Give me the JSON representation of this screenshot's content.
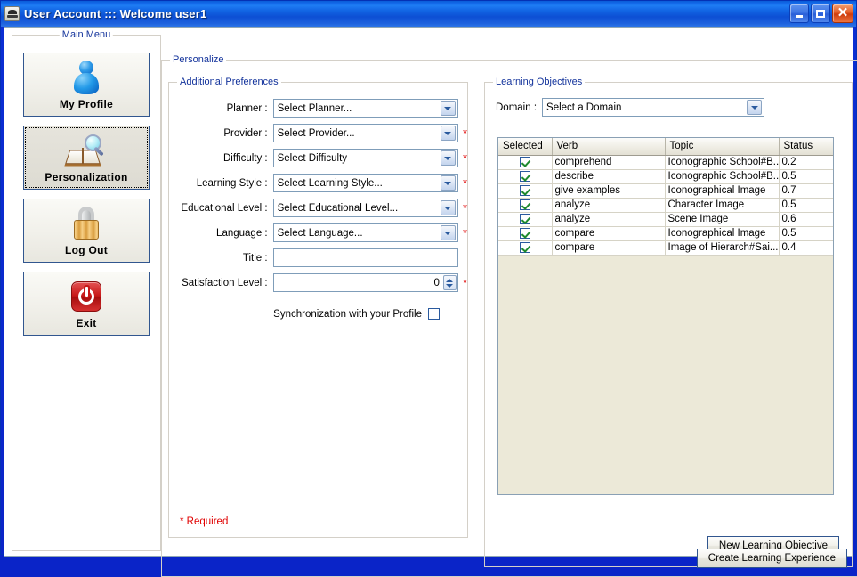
{
  "window": {
    "title": "User Account ::: Welcome user1",
    "icon": "java-cup-icon",
    "minimize_label": "",
    "maximize_label": "",
    "close_label": "✕"
  },
  "sidebar": {
    "title": "Main Menu",
    "items": [
      {
        "label": "My Profile",
        "icon": "person-icon",
        "selected": false
      },
      {
        "label": "Personalization",
        "icon": "book-search-icon",
        "selected": true
      },
      {
        "label": "Log Out",
        "icon": "padlock-icon",
        "selected": false
      },
      {
        "label": "Exit",
        "icon": "power-icon",
        "selected": false
      }
    ]
  },
  "personalize": {
    "title": "Personalize"
  },
  "preferences": {
    "title": "Additional Preferences",
    "fields": [
      {
        "label": "Planner :",
        "type": "combo",
        "value": "Select Planner...",
        "required": false
      },
      {
        "label": "Provider :",
        "type": "combo",
        "value": "Select Provider...",
        "required": true
      },
      {
        "label": "Difficulty :",
        "type": "combo",
        "value": "Select Difficulty",
        "required": true
      },
      {
        "label": "Learning Style :",
        "type": "combo",
        "value": "Select Learning Style...",
        "required": true
      },
      {
        "label": "Educational Level :",
        "type": "combo",
        "value": "Select Educational Level...",
        "required": true
      },
      {
        "label": "Language :",
        "type": "combo",
        "value": "Select Language...",
        "required": true
      },
      {
        "label": "Title :",
        "type": "text",
        "value": "",
        "required": false
      },
      {
        "label": "Satisfaction Level :",
        "type": "spinner",
        "value": "0",
        "required": true
      }
    ],
    "sync_label": "Synchronization with your Profile",
    "sync_checked": false,
    "required_note": "* Required",
    "required_marker": "*"
  },
  "objectives": {
    "title": "Learning Objectives",
    "domain_label": "Domain :",
    "domain_value": "Select a Domain",
    "columns": [
      "Selected",
      "Verb",
      "Topic",
      "Status"
    ],
    "rows": [
      {
        "selected": true,
        "verb": "comprehend",
        "topic": "Iconographic School#B...",
        "status": "0.2"
      },
      {
        "selected": true,
        "verb": "describe",
        "topic": "Iconographic School#B...",
        "status": "0.5"
      },
      {
        "selected": true,
        "verb": "give examples",
        "topic": "Iconographical Image",
        "status": "0.7"
      },
      {
        "selected": true,
        "verb": "analyze",
        "topic": "Character Image",
        "status": "0.5"
      },
      {
        "selected": true,
        "verb": "analyze",
        "topic": "Scene Image",
        "status": "0.6"
      },
      {
        "selected": true,
        "verb": "compare",
        "topic": "Iconographical Image",
        "status": "0.5"
      },
      {
        "selected": true,
        "verb": "compare",
        "topic": "Image of Hierarch#Sai...",
        "status": "0.4"
      }
    ],
    "new_button": "New Learning Objective"
  },
  "footer": {
    "create_button": "Create Learning Experience"
  },
  "colors": {
    "title_blue": "#1268E8",
    "panel_title": "#12329B",
    "required_red": "#E00000",
    "control_bg": "#ECE9D8",
    "button_border": "#31568F",
    "field_border": "#7F9DB9"
  }
}
